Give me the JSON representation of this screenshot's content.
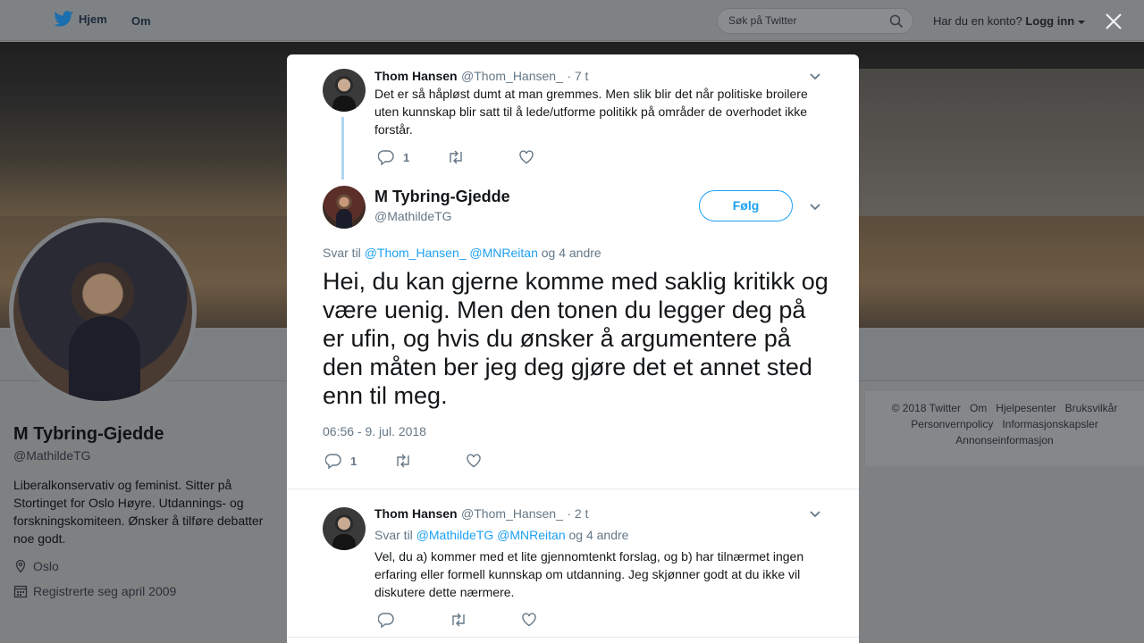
{
  "nav": {
    "home_label": "Hjem",
    "about_label": "Om",
    "search_placeholder": "Søk på Twitter",
    "account_prompt": "Har du en konto?",
    "login_label": "Logg inn"
  },
  "profile": {
    "name": "M Tybring-Gjedde",
    "handle": "@MathildeTG",
    "bio": "Liberalkonservativ og feminist. Sitter på Stortinget for Oslo Høyre. Utdannings- og forskningskomiteen. Ønsker å tilføre debatter noe godt.",
    "location": "Oslo",
    "joined": "Registrerte seg april 2009"
  },
  "footer": {
    "links": [
      "© 2018 Twitter",
      "Om",
      "Hjelpesenter",
      "Bruksvilkår",
      "Personvernpolicy",
      "Informasjonskapsler",
      "Annonseinformasjon"
    ]
  },
  "tweets": {
    "parent": {
      "name": "Thom Hansen",
      "handle": "@Thom_Hansen_",
      "time": "· 7 t",
      "text": "Det er så håpløst dumt at man gremmes. Men slik blir det når politiske broilere uten kunnskap blir satt til å lede/utforme politikk på områder de overhodet ikke forstår.",
      "reply_count": "1"
    },
    "main": {
      "name": "M Tybring-Gjedde",
      "handle": "@MathildeTG",
      "follow_label": "Følg",
      "reply_prefix": "Svar til",
      "reply_mention_1": "@Thom_Hansen_",
      "reply_mention_2": "@MNReitan",
      "reply_suffix": "og 4 andre",
      "text": "Hei, du kan gjerne komme med saklig kritikk og være uenig. Men den tonen du legger deg på er ufin, og hvis du ønsker å argumentere på den måten ber jeg deg gjøre det et annet sted enn til meg.",
      "timestamp": "06:56 - 9. jul. 2018",
      "reply_count": "1"
    },
    "reply": {
      "name": "Thom Hansen",
      "handle": "@Thom_Hansen_",
      "time": "· 2 t",
      "reply_prefix": "Svar til",
      "reply_mention_1": "@MathildeTG",
      "reply_mention_2": "@MNReitan",
      "reply_suffix": "og 4 andre",
      "text": "Vel, du a) kommer med et lite gjennomtenkt forslag, og b) har tilnærmet ingen erfaring eller formell kunnskap om utdanning. Jeg skjønner godt at du ikke vil diskutere dette nærmere."
    }
  },
  "colors": {
    "accent": "#1da1f2",
    "muted": "#657786",
    "text": "#14171a"
  },
  "icons": [
    "twitter-bird-icon",
    "search-icon",
    "close-icon",
    "chevron-down-icon",
    "reply-icon",
    "retweet-icon",
    "like-icon",
    "location-icon",
    "calendar-icon"
  ]
}
